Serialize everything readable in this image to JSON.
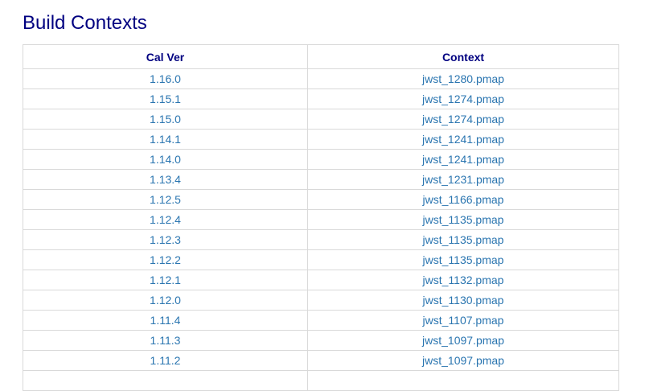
{
  "page": {
    "title": "Build Contexts"
  },
  "table": {
    "headers": [
      "Cal Ver",
      "Context"
    ],
    "rows": [
      {
        "calver": "1.16.0",
        "context": "jwst_1280.pmap"
      },
      {
        "calver": "1.15.1",
        "context": "jwst_1274.pmap"
      },
      {
        "calver": "1.15.0",
        "context": "jwst_1274.pmap"
      },
      {
        "calver": "1.14.1",
        "context": "jwst_1241.pmap"
      },
      {
        "calver": "1.14.0",
        "context": "jwst_1241.pmap"
      },
      {
        "calver": "1.13.4",
        "context": "jwst_1231.pmap"
      },
      {
        "calver": "1.12.5",
        "context": "jwst_1166.pmap"
      },
      {
        "calver": "1.12.4",
        "context": "jwst_1135.pmap"
      },
      {
        "calver": "1.12.3",
        "context": "jwst_1135.pmap"
      },
      {
        "calver": "1.12.2",
        "context": "jwst_1135.pmap"
      },
      {
        "calver": "1.12.1",
        "context": "jwst_1132.pmap"
      },
      {
        "calver": "1.12.0",
        "context": "jwst_1130.pmap"
      },
      {
        "calver": "1.11.4",
        "context": "jwst_1107.pmap"
      },
      {
        "calver": "1.11.3",
        "context": "jwst_1097.pmap"
      },
      {
        "calver": "1.11.2",
        "context": "jwst_1097.pmap"
      },
      {
        "calver": "",
        "context": ""
      }
    ]
  },
  "colors": {
    "heading": "#000080",
    "link": "#2a75b0",
    "border": "#d9d9d9"
  }
}
